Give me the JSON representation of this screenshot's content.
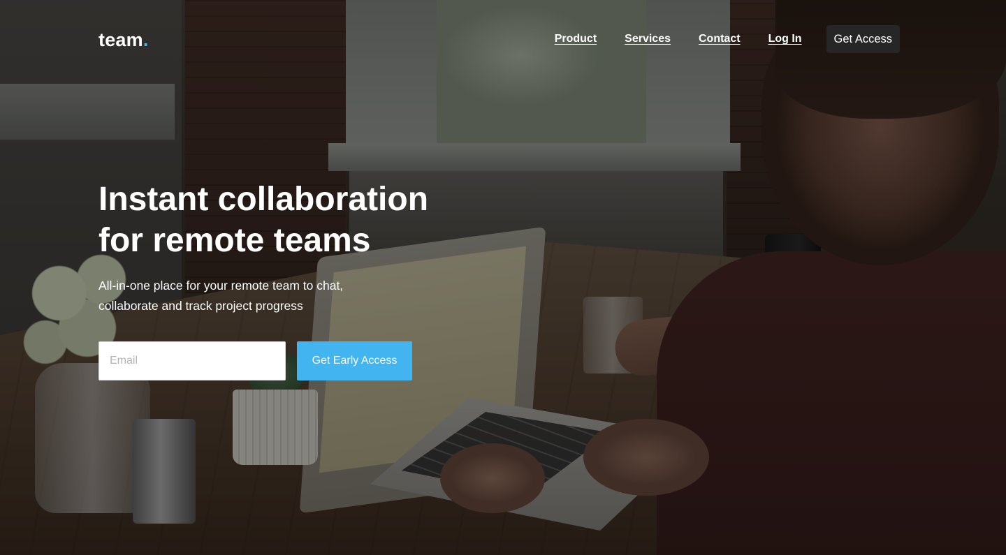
{
  "brand": {
    "logo_text": "team",
    "logo_dot": ".",
    "accent_color": "#3fb6f2"
  },
  "nav": {
    "items": [
      {
        "label": "Product"
      },
      {
        "label": "Services"
      },
      {
        "label": "Contact"
      },
      {
        "label": "Log In"
      }
    ],
    "cta_label": "Get Access"
  },
  "hero": {
    "title_line1": "Instant collaboration",
    "title_line2": "for remote teams",
    "subtitle_line1": "All-in-one place for your remote team to chat,",
    "subtitle_line2": "collaborate and track project progress",
    "email_placeholder": "Email",
    "email_value": "",
    "button_label": "Get Early Access",
    "button_color": "#42b4ef",
    "background_image": "person typing on laptop at wooden desk by window"
  }
}
